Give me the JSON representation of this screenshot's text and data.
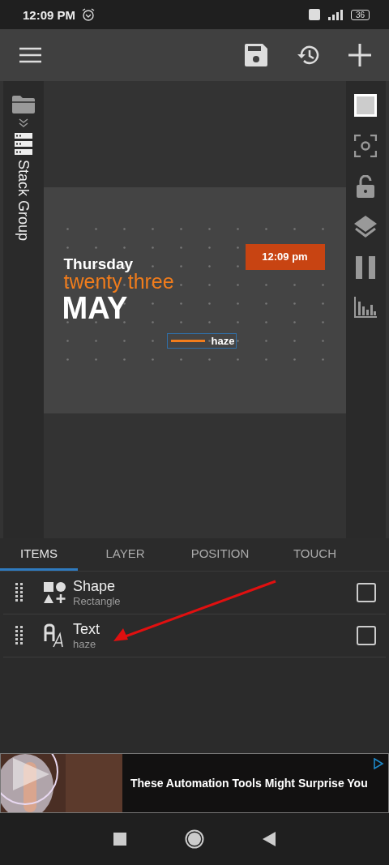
{
  "status_bar": {
    "time": "12:09 PM",
    "battery": "36"
  },
  "left_rail": {
    "label": "Stack Group"
  },
  "preview": {
    "day": "Thursday",
    "date": "twenty three",
    "month": "MAY",
    "time": "12:09 pm",
    "caption": "haze"
  },
  "tabs": [
    {
      "label": "ITEMS",
      "selected": true
    },
    {
      "label": "LAYER",
      "selected": false
    },
    {
      "label": "POSITION",
      "selected": false
    },
    {
      "label": "TOUCH",
      "selected": false
    }
  ],
  "items": [
    {
      "kind": "shape",
      "title": "Shape",
      "subtitle": "Rectangle",
      "checked": false
    },
    {
      "kind": "text",
      "title": "Text",
      "subtitle": "haze",
      "checked": false
    }
  ],
  "ad": {
    "headline": "These Automation Tools Might Surprise You"
  }
}
